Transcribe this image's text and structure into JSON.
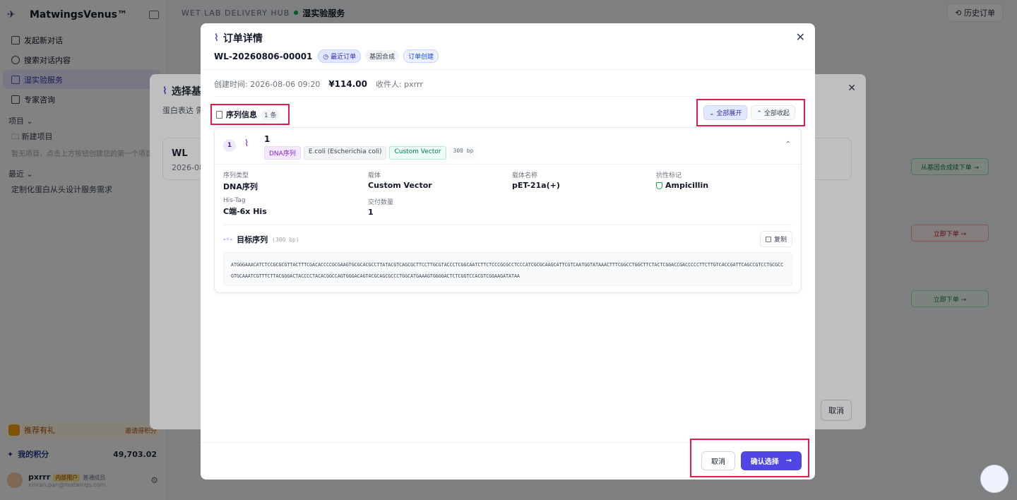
{
  "app": {
    "brand": "MatwingsVenus™",
    "nav": [
      {
        "label": "发起新对话",
        "active": false
      },
      {
        "label": "搜索对话内容",
        "active": false
      },
      {
        "label": "湿实验服务",
        "active": true
      },
      {
        "label": "专家咨询",
        "active": false
      }
    ],
    "projects_label": "项目",
    "new_project": "新建项目",
    "projects_empty": "暂无项目，点击上方按钮创建您的第一个项目",
    "recent_label": "最近",
    "recent_item": "定制化蛋白从头设计服务需求",
    "promo_label": "推荐有礼",
    "promo_hint": "邀请得积分",
    "points_label": "我的积分",
    "points_value": "49,703.02",
    "user_name": "pxrrr",
    "user_tag": "内部用户",
    "user_level": "普通成员",
    "user_email": "xinran.pan@matwings.com"
  },
  "topbar": {
    "hub": "WET LAB DELIVERY HUB",
    "service": "湿实验服务",
    "history": "历史订单"
  },
  "background_buttons": {
    "from_gene": "从基因合成续下单 →",
    "order_now_1": "立即下单 →",
    "order_now_2": "立即下单 →"
  },
  "modal_behind": {
    "title": "选择基",
    "subtitle": "蛋白表达 需",
    "card_title": "WL",
    "card_date": "2026-08",
    "cancel": "取消"
  },
  "order": {
    "title": "订单详情",
    "id": "WL-20260806-00001",
    "tags": {
      "recent": "最近订单",
      "gene": "基因合成",
      "create": "订单创建"
    },
    "created_label": "创建时间: 2026-08-06 09:20",
    "price": "¥114.00",
    "recipient": "收件人: pxrrr",
    "section_label": "序列信息",
    "section_count": "1 条",
    "expand_all": "全部展开",
    "collapse_all": "全部收起",
    "sequence": {
      "index": "1",
      "name": "1",
      "tags": {
        "type": "DNA序列",
        "host": "E.coli (Escherichia coli)",
        "vector": "Custom Vector",
        "bp": "300 bp"
      },
      "fields": {
        "seq_type_k": "序列类型",
        "seq_type_v": "DNA序列",
        "vector_k": "载体",
        "vector_v": "Custom Vector",
        "vector_name_k": "载体名称",
        "vector_name_v": "pET-21a(+)",
        "resist_k": "抗性标记",
        "resist_v": "Ampicillin",
        "histag_k": "His-Tag",
        "histag_v": "C端-6x His",
        "qty_k": "交付数量",
        "qty_v": "1"
      },
      "target_label": "目标序列",
      "target_bp": "(300 bp)",
      "copy": "复制",
      "dna": "ATGGGAAACATCTCCGCGCGTTACTTTCGACACCCCGCGAAGTGCGCACGCCTTATACGTCAGCGCTTCCTTGCGTACCCTCGGCAATCTTCTCCCGCGCCTCCCATCGCGCAAGCATTCGTCAATGGTATAAACTTTCGGCCTGGCTTCTACTCGGACCGACCCCCTTCTTGTCACCGATTCAGCCGTCCTGCGCCGTGCAAATCGTTTCTTACGGGACTACCCCTACACGGCCAGTGGGACAGTACGCAGCGCCCTGGCATGAAAGTGGGGACTCTCGGTCCACGTCGGAAGATATAA"
    },
    "cancel": "取消",
    "confirm": "确认选择",
    "confirm_arrow": "→"
  }
}
